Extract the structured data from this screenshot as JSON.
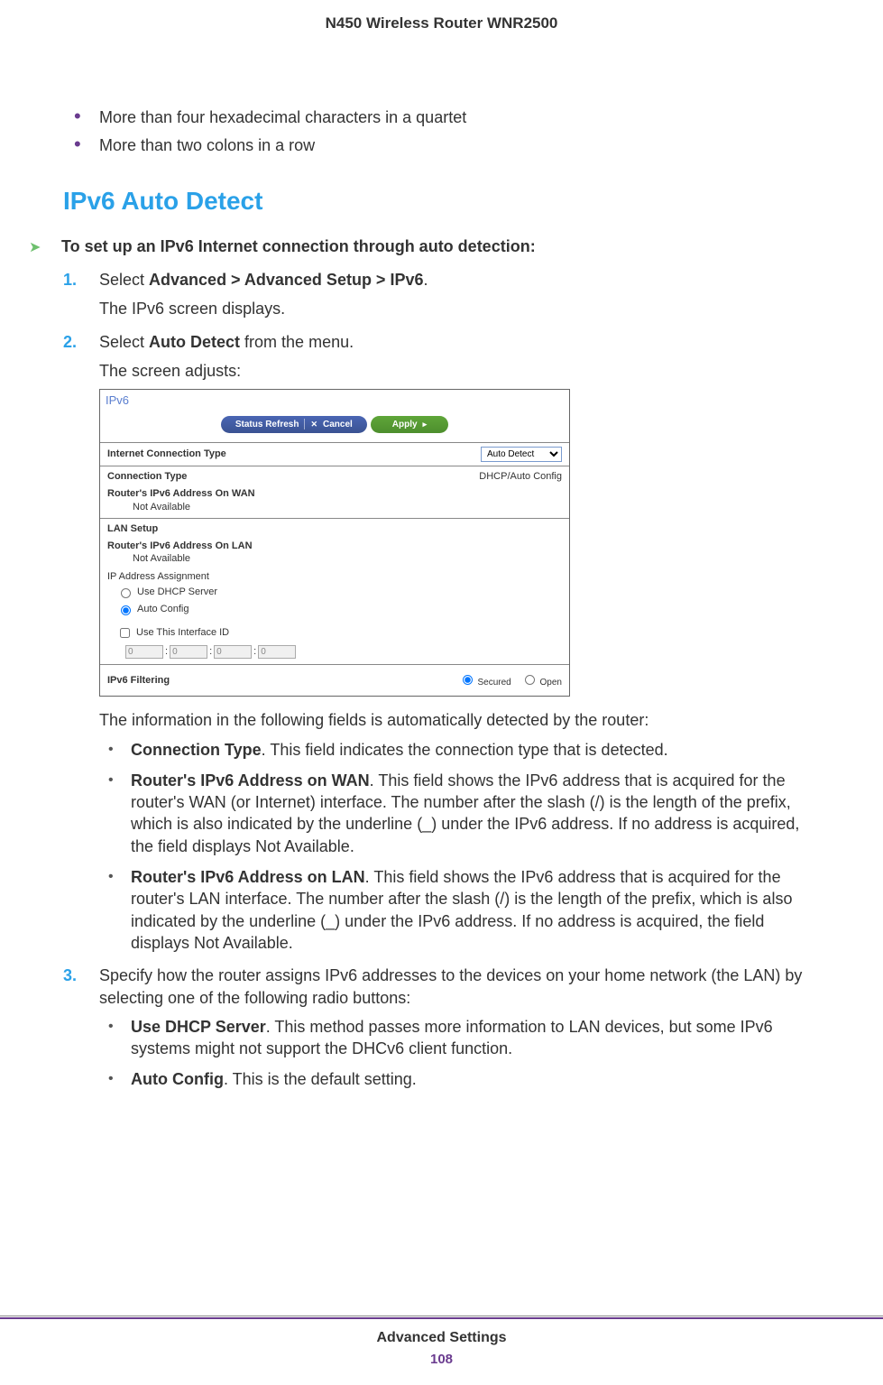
{
  "header": "N450 Wireless Router WNR2500",
  "intro_bullets": [
    "More than four hexadecimal characters in a quartet",
    "More than two colons in a row"
  ],
  "section_heading": "IPv6 Auto Detect",
  "arrow_intro": "To set up an IPv6 Internet connection through auto detection:",
  "steps": {
    "s1": {
      "line1_pre": "Select ",
      "line1_bold": "Advanced > Advanced Setup > IPv6",
      "line1_post": ".",
      "line2": "The IPv6 screen displays."
    },
    "s2": {
      "line1_pre": "Select ",
      "line1_bold": "Auto Detect",
      "line1_post": " from the menu.",
      "line2": "The screen adjusts:",
      "after_ss": "The information in the following fields is automatically detected by the router:",
      "fields": [
        {
          "bold": "Connection Type",
          "text": ". This field indicates the connection type that is detected."
        },
        {
          "bold": "Router's IPv6 Address on WAN",
          "text": ". This field shows the IPv6 address that is acquired for the router's WAN (or Internet) interface. The number after the slash (/) is the length of the prefix, which is also indicated by the underline (_) under the IPv6 address. If no address is acquired, the field displays Not Available."
        },
        {
          "bold": "Router's IPv6 Address on LAN",
          "text": ". This field shows the IPv6 address that is acquired for the router's LAN interface. The number after the slash (/) is the length of the prefix, which is also indicated by the underline (_) under the IPv6 address. If no address is acquired, the field displays Not Available."
        }
      ]
    },
    "s3": {
      "line1": "Specify how the router assigns IPv6 addresses to the devices on your home network (the LAN) by selecting one of the following radio buttons:",
      "opts": [
        {
          "bold": "Use DHCP Server",
          "text": ". This method passes more information to LAN devices, but some IPv6 systems might not support the DHCv6 client function."
        },
        {
          "bold": "Auto Config",
          "text": ". This is the default setting."
        }
      ]
    }
  },
  "screenshot": {
    "title": "IPv6",
    "btn_refresh": "Status Refresh",
    "btn_cancel": "Cancel",
    "btn_apply": "Apply",
    "ict_label": "Internet Connection Type",
    "ict_value": "Auto Detect",
    "conn_type_label": "Connection Type",
    "conn_type_value": "DHCP/Auto Config",
    "wan_label": "Router's IPv6 Address On WAN",
    "wan_value": "Not Available",
    "lan_setup": "LAN Setup",
    "lan_label": "Router's IPv6 Address On LAN",
    "lan_value": "Not Available",
    "ip_assign": "IP Address Assignment",
    "radio_dhcp": "Use DHCP Server",
    "radio_auto": "Auto Config",
    "use_iface": "Use This Interface ID",
    "iface_vals": [
      "0",
      "0",
      "0",
      "0"
    ],
    "filter_label": "IPv6 Filtering",
    "filter_secured": "Secured",
    "filter_open": "Open"
  },
  "footer": {
    "section": "Advanced Settings",
    "page": "108"
  }
}
